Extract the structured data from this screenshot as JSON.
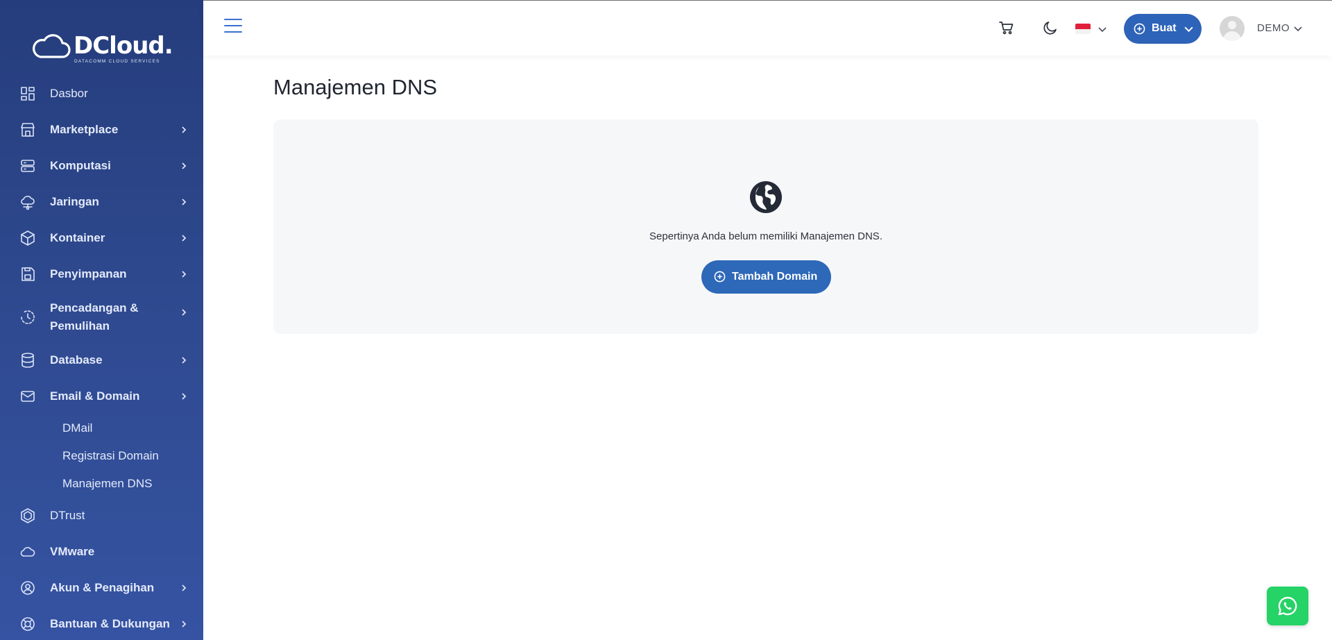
{
  "brand": {
    "name": "DCloud.",
    "tagline": "DATACOMM CLOUD SERVICES"
  },
  "sidebar": {
    "items": [
      {
        "label": "Dasbor",
        "icon": "grid-icon",
        "has_children": false
      },
      {
        "label": "Marketplace",
        "icon": "store-icon",
        "has_children": true
      },
      {
        "label": "Komputasi",
        "icon": "server-icon",
        "has_children": true
      },
      {
        "label": "Jaringan",
        "icon": "cloud-network-icon",
        "has_children": true
      },
      {
        "label": "Kontainer",
        "icon": "cube-icon",
        "has_children": true
      },
      {
        "label": "Penyimpanan",
        "icon": "floppy-icon",
        "has_children": true
      },
      {
        "label": "Pencadangan & Pemulihan",
        "icon": "backup-clock-icon",
        "has_children": true
      },
      {
        "label": "Database",
        "icon": "database-icon",
        "has_children": true
      },
      {
        "label": "Email & Domain",
        "icon": "mail-icon",
        "has_children": true,
        "expanded": true,
        "children": [
          {
            "label": "DMail"
          },
          {
            "label": "Registrasi Domain"
          },
          {
            "label": "Manajemen DNS",
            "active": true
          }
        ]
      },
      {
        "label": "DTrust",
        "icon": "hexagon-shield-icon",
        "has_children": false
      },
      {
        "label": "VMware",
        "icon": "cloud-icon",
        "has_children": false
      },
      {
        "label": "Akun & Penagihan",
        "icon": "user-circle-icon",
        "has_children": true
      },
      {
        "label": "Bantuan & Dukungan",
        "icon": "lifebuoy-icon",
        "has_children": true
      }
    ]
  },
  "topbar": {
    "create_label": "Buat",
    "username": "DEMO",
    "language": "Indonesia"
  },
  "main": {
    "title": "Manajemen DNS",
    "empty_message": "Sepertinya Anda belum memiliki Manajemen DNS.",
    "add_button_label": "Tambah Domain"
  },
  "colors": {
    "sidebar_top": "#253d7c",
    "sidebar_bottom": "#3553a2",
    "primary_button": "#2d63b8",
    "whatsapp": "#25d366"
  }
}
